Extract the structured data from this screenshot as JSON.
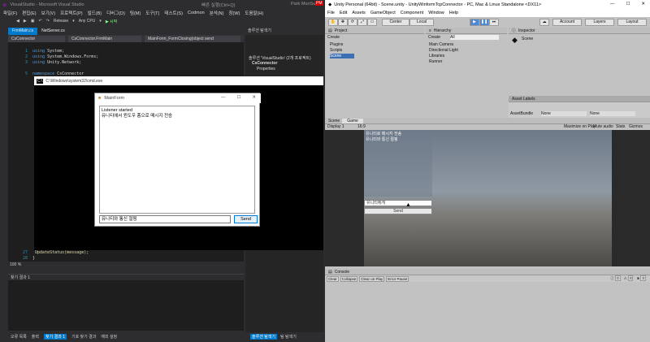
{
  "vs": {
    "title": "VisualStudio - Microsoft Visual Studio",
    "quick_launch": "빠른 실행(Ctrl+Q)",
    "user": "Park MunSu",
    "pm": "PM",
    "menu": [
      "파일(F)",
      "편집(E)",
      "보기(V)",
      "프로젝트(P)",
      "빌드(B)",
      "디버그(D)",
      "팀(M)",
      "도구(T)",
      "테스트(S)",
      "Codmon",
      "분석(N)",
      "창(W)",
      "도움말(H)"
    ],
    "toolbar": {
      "config": "Release",
      "platform": "Any CPU",
      "start": "▶ 시작"
    },
    "tabs": [
      "FrmMain.cs",
      "NetServer.cs"
    ],
    "nav": {
      "project": "CsConnector",
      "class": "CsConnector.FrmMain",
      "member": "MainForm_FormClosing(object send"
    },
    "code": [
      {
        "ln": "1",
        "kw": "using",
        "rest": " System;"
      },
      {
        "ln": "2",
        "kw": "using",
        "rest": " System.Windows.Forms;"
      },
      {
        "ln": "3",
        "kw": "using",
        "rest": " Unity.Network;"
      },
      {
        "ln": "5",
        "kw": "namespace",
        "rest": " CsConnector"
      },
      {
        "ln": "27",
        "kw": "",
        "rest": "    UpdateStatus(message);"
      },
      {
        "ln": "28",
        "kw": "",
        "rest": "}"
      }
    ],
    "zoom": "100 %",
    "find_title": "찾기 결과 1",
    "bottom_tabs": [
      "오류 목록",
      "출력",
      "찾기 결과 1",
      "기호 찾기 결과",
      "예외 설정"
    ],
    "solution": {
      "header": "솔루션 탐색기",
      "items": [
        "솔루션 'VisualStudio' (2개 프로젝트)",
        "CsConnector",
        "Properties"
      ]
    },
    "sol_bottom_tabs": [
      "솔루션 탐색기",
      "팀 탐색기"
    ]
  },
  "cmd": {
    "title": "C:\\Windows\\system32\\cmd.exe"
  },
  "mainform": {
    "title": "MainForm",
    "log": [
      "Listener started",
      "유니티에서 윈도우 폼으로 메시지 전송"
    ],
    "input": "유니티와 통신 절핑",
    "send": "Send"
  },
  "unity": {
    "title": "Unity Personal (64bit) - Scene.unity - UnityWinformTcpConnector - PC, Mac & Linux Standalone <DX11>",
    "menu": [
      "File",
      "Edit",
      "Assets",
      "GameObject",
      "Component",
      "Window",
      "Help"
    ],
    "toolbar": {
      "center": "Center",
      "local": "Local",
      "account": "Account",
      "layers": "Layers",
      "layout": "Layout"
    },
    "project": {
      "tab": "Project",
      "create": "Create",
      "items": [
        "Plugins",
        "Scripts",
        "Scene"
      ]
    },
    "hierarchy": {
      "tab": "Hierarchy",
      "create": "Create",
      "search": "All",
      "items": [
        "Main Camera",
        "Directional Light",
        "Libraries",
        "Runner"
      ]
    },
    "inspector": {
      "tab": "Inspector",
      "object": "Scene"
    },
    "asset_labels": {
      "title": "Asset Labels",
      "bundle_label": "AssetBundle",
      "bundle_value": "None",
      "variant_value": "None"
    },
    "view_tabs": [
      "Scene",
      "Game"
    ],
    "game_bar": {
      "display": "Display 1",
      "aspect": "16:9",
      "maximize": "Maximize on Play",
      "mute": "Mute audio",
      "stats": "Stats",
      "gizmos": "Gizmos"
    },
    "game_ui": {
      "log": [
        "유니티로 메시지 전송",
        "유니티와 통신 절핑"
      ],
      "input": "유니티에게",
      "send": "Send"
    },
    "console": {
      "tab": "Console",
      "buttons": [
        "Clear",
        "Collapse",
        "Clear on Play",
        "Error Pause"
      ],
      "counts": [
        "0",
        "0",
        "0"
      ]
    }
  }
}
